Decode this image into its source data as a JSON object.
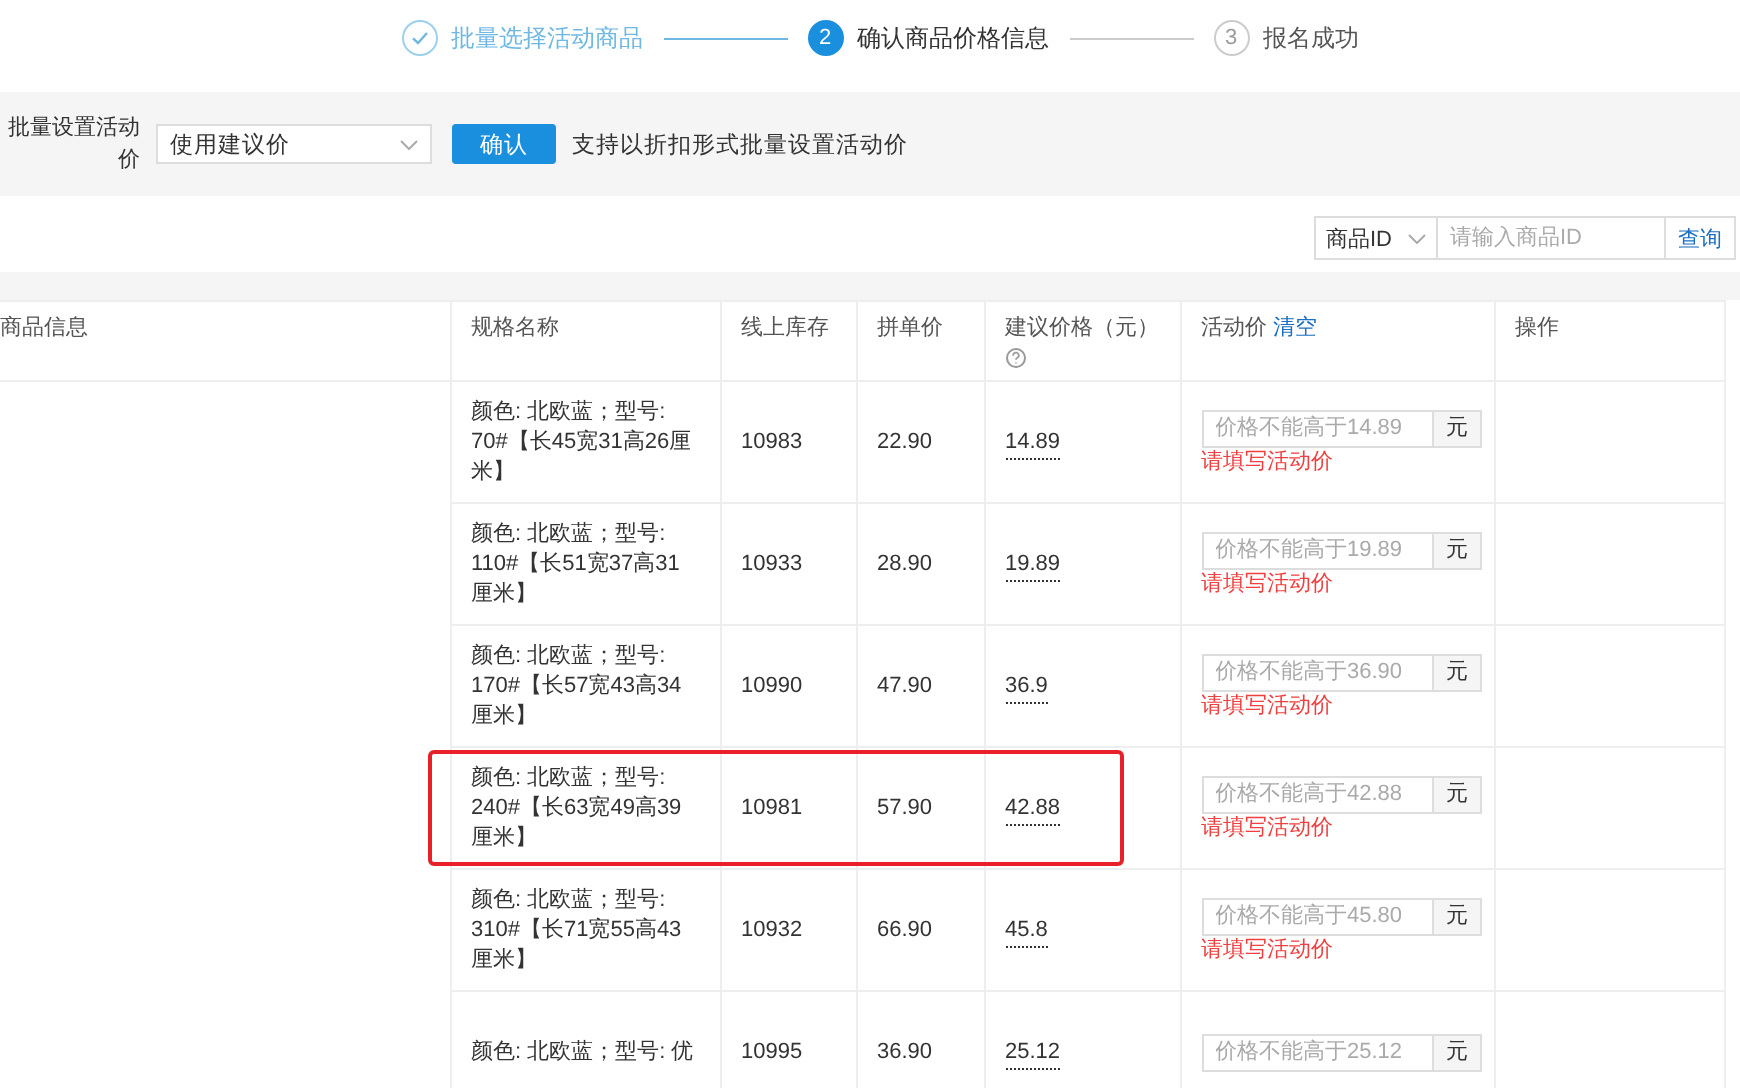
{
  "steps": [
    {
      "label": "批量选择活动商品",
      "completed": true,
      "selected": false
    },
    {
      "number": "2",
      "label": "确认商品价格信息",
      "completed": false,
      "selected": true
    },
    {
      "number": "3",
      "label": "报名成功",
      "completed": false,
      "selected": false
    }
  ],
  "batch_setting": {
    "label": "批量设置活动价",
    "select_value": "使用建议价",
    "confirm_button": "确认",
    "hint": "支持以折扣形式批量设置活动价"
  },
  "search": {
    "field_select": "商品ID",
    "placeholder": "请输入商品ID",
    "button": "查询"
  },
  "table": {
    "columns": [
      "商品信息",
      "规格名称",
      "线上库存",
      "拼单价",
      "建议价格（元）",
      "活动价",
      "操作"
    ],
    "clear_link": "清空",
    "rows": [
      {
        "spec": "颜色: 北欧蓝；型号: 70#【长45宽31高26厘米】",
        "stock": "10983",
        "group_price": "22.90",
        "suggested_price": "14.89",
        "placeholder": "价格不能高于14.89",
        "unit": "元",
        "error": "请填写活动价",
        "highlighted": false
      },
      {
        "spec": "颜色: 北欧蓝；型号: 110#【长51宽37高31厘米】",
        "stock": "10933",
        "group_price": "28.90",
        "suggested_price": "19.89",
        "placeholder": "价格不能高于19.89",
        "unit": "元",
        "error": "请填写活动价",
        "highlighted": false
      },
      {
        "spec": "颜色: 北欧蓝；型号: 170#【长57宽43高34厘米】",
        "stock": "10990",
        "group_price": "47.90",
        "suggested_price": "36.9",
        "placeholder": "价格不能高于36.90",
        "unit": "元",
        "error": "请填写活动价",
        "highlighted": false
      },
      {
        "spec": "颜色: 北欧蓝；型号: 240#【长63宽49高39厘米】",
        "stock": "10981",
        "group_price": "57.90",
        "suggested_price": "42.88",
        "placeholder": "价格不能高于42.88",
        "unit": "元",
        "error": "请填写活动价",
        "highlighted": true
      },
      {
        "spec": "颜色: 北欧蓝；型号: 310#【长71宽55高43厘米】",
        "stock": "10932",
        "group_price": "66.90",
        "suggested_price": "45.8",
        "placeholder": "价格不能高于45.80",
        "unit": "元",
        "error": "请填写活动价",
        "highlighted": false
      },
      {
        "spec": "颜色: 北欧蓝；型号: 优",
        "stock": "10995",
        "group_price": "36.90",
        "suggested_price": "25.12",
        "placeholder": "价格不能高于25.12",
        "unit": "元",
        "highlighted": false
      }
    ]
  }
}
